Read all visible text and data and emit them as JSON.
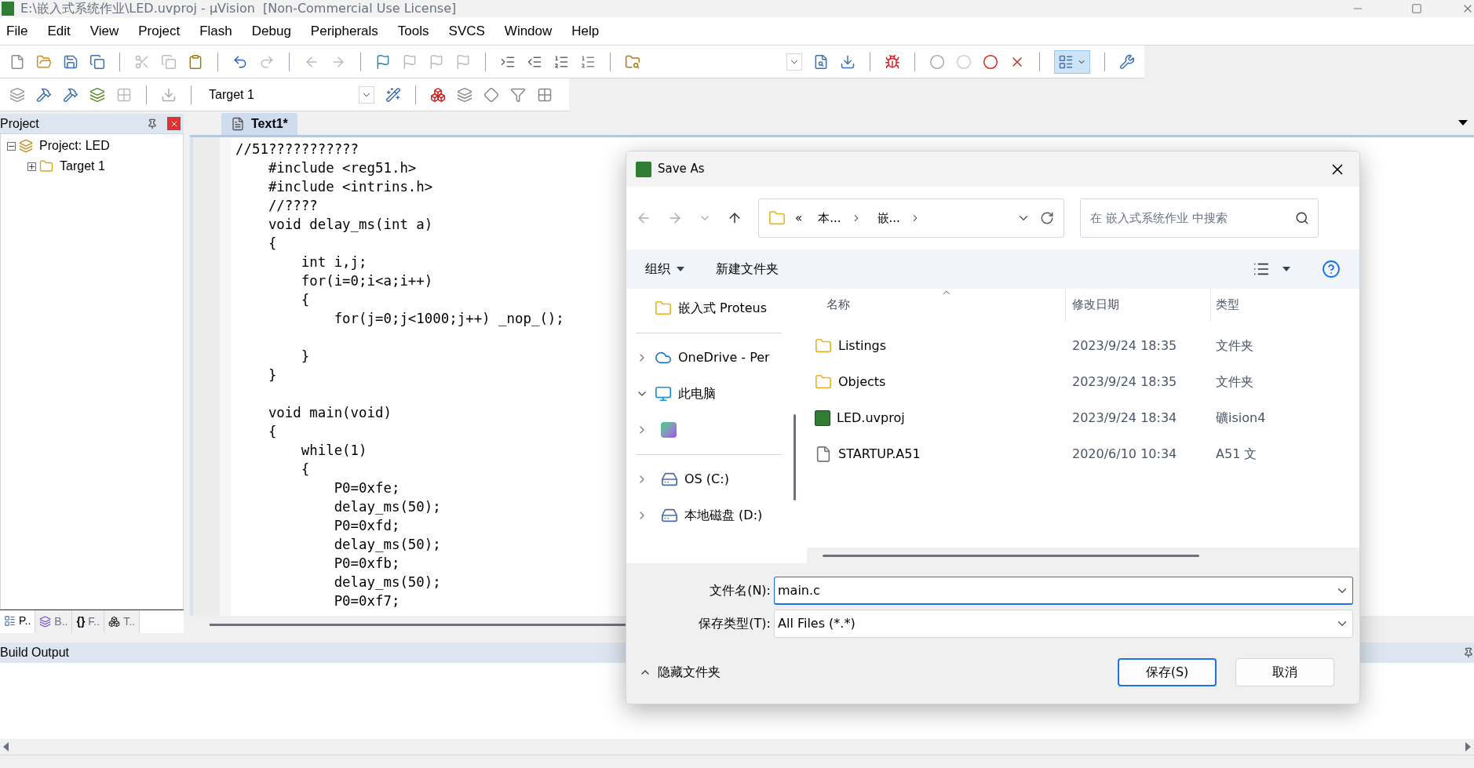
{
  "window": {
    "title": "E:\\嵌入式系统作业\\LED.uvproj - µVision  [Non-Commercial Use License]"
  },
  "menu": [
    "File",
    "Edit",
    "View",
    "Project",
    "Flash",
    "Debug",
    "Peripherals",
    "Tools",
    "SVCS",
    "Window",
    "Help"
  ],
  "toolbar": {
    "target": "Target 1"
  },
  "project_panel": {
    "title": "Project",
    "tree": [
      {
        "label": "Project: LED",
        "expanded": true,
        "children": [
          {
            "label": "Target 1",
            "expanded": false
          }
        ]
      }
    ],
    "tabs": [
      {
        "label": "P..",
        "selected": true
      },
      {
        "label": "B..",
        "selected": false
      },
      {
        "glyph": "{}",
        "label": "F..",
        "selected": false
      },
      {
        "label": "T..",
        "selected": false
      }
    ]
  },
  "editor": {
    "tabs": [
      {
        "label": "Text1*",
        "selected": true
      }
    ],
    "blocks": [
      [
        "//51???????????",
        "    #include <reg51.h>",
        "    #include <intrins.h>",
        "    //????",
        "    void delay_ms(int a)",
        "    {",
        "        int i,j;",
        "        for(i=0;i<a;i++)",
        "        {",
        "            for(j=0;j<1000;j++) _nop_();"
      ],
      [
        "        }",
        "    }"
      ],
      [
        "    void main(void)",
        "    {",
        "        while(1)",
        "        {",
        "            P0=0xfe;",
        "            delay_ms(50);",
        "            P0=0xfd;",
        "            delay_ms(50);",
        "            P0=0xfb;",
        "            delay_ms(50);",
        "            P0=0xf7;"
      ]
    ]
  },
  "build_output": {
    "title": "Build Output"
  },
  "dialog": {
    "title": "Save As",
    "address": {
      "overflow": "«",
      "crumbs": [
        "本...",
        "嵌..."
      ]
    },
    "search": {
      "placeholder": "在 嵌入式系统作业 中搜索"
    },
    "commands": [
      {
        "label": "组织",
        "dropdown": true
      },
      {
        "label": "新建文件夹",
        "dropdown": false
      }
    ],
    "nav": [
      {
        "label": "嵌入式 Proteus",
        "kind": "folder"
      },
      {
        "label": "OneDrive - Per",
        "kind": "cloud",
        "expanded": false
      },
      {
        "label": "此电脑",
        "kind": "computer",
        "expanded": true
      },
      {
        "kind": "app",
        "expanded": false
      },
      {
        "label": "OS (C:)",
        "kind": "drive",
        "expanded": false
      },
      {
        "label": "本地磁盘 (D:)",
        "kind": "drive",
        "expanded": false
      }
    ],
    "columns": [
      {
        "label": "名称",
        "sorted": true
      },
      {
        "label": "修改日期",
        "sorted": false
      },
      {
        "label": "类型",
        "sorted": false
      }
    ],
    "files": [
      {
        "name": "Listings",
        "date": "2023/9/24 18:35",
        "type": "文件夹",
        "kind": "folder"
      },
      {
        "name": "Objects",
        "date": "2023/9/24 18:35",
        "type": "文件夹",
        "kind": "folder"
      },
      {
        "name": "LED.uvproj",
        "date": "2023/9/24 18:34",
        "type": "礦ision4",
        "kind": "project"
      },
      {
        "name": "STARTUP.A51",
        "date": "2020/6/10 10:34",
        "type": "A51 文",
        "kind": "file"
      }
    ],
    "filename": {
      "label": "文件名(N):",
      "value": "main.c"
    },
    "filetype": {
      "label": "保存类型(T):",
      "value": "All Files (*.*)"
    },
    "hide_folders": {
      "label": "隐藏文件夹",
      "expanded": true
    },
    "buttons": [
      {
        "label": "保存(S)",
        "primary": true
      },
      {
        "label": "取消",
        "primary": false
      }
    ]
  }
}
